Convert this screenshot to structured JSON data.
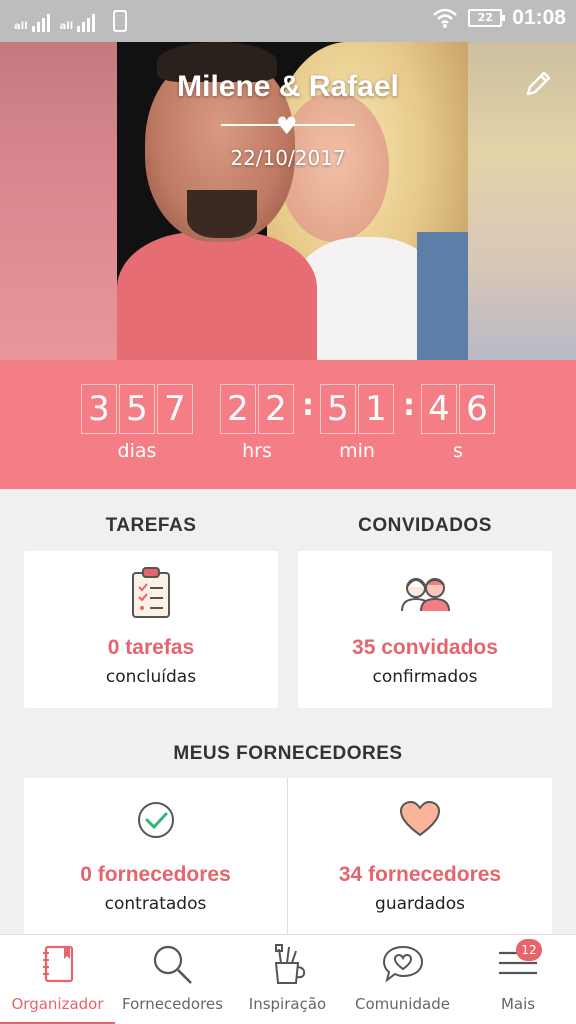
{
  "status_bar": {
    "signal1": "all",
    "signal2": "all",
    "battery": "22",
    "time": "01:08"
  },
  "header": {
    "couple_name": "Milene & Rafael",
    "date": "22/10/2017",
    "icons": [
      "heart-icon",
      "pencil-icon"
    ]
  },
  "countdown": {
    "days_digits": [
      "3",
      "5",
      "7"
    ],
    "hours_digits": [
      "2",
      "2"
    ],
    "minutes_digits": [
      "5",
      "1"
    ],
    "seconds_digits": [
      "4",
      "6"
    ],
    "separator": ":",
    "labels": {
      "days": "dias",
      "hours": "hrs",
      "minutes": "min",
      "seconds": "s"
    }
  },
  "tasks": {
    "title": "TAREFAS",
    "value": "0 tarefas",
    "sub": "concluídas",
    "icon": "clipboard-checklist-icon"
  },
  "guests": {
    "title": "CONVIDADOS",
    "value": "35 convidados",
    "sub": "confirmados",
    "icon": "guests-couple-icon"
  },
  "vendors": {
    "title": "MEUS FORNECEDORES",
    "hired": {
      "value": "0 fornecedores",
      "sub": "contratados",
      "icon": "check-circle-icon"
    },
    "saved": {
      "value": "34 fornecedores",
      "sub": "guardados",
      "icon": "heart-icon"
    }
  },
  "bottom_nav": {
    "items": [
      {
        "label": "Organizador",
        "icon": "notebook-icon",
        "active": true
      },
      {
        "label": "Fornecedores",
        "icon": "search-icon"
      },
      {
        "label": "Inspiração",
        "icon": "brushes-cup-icon"
      },
      {
        "label": "Comunidade",
        "icon": "chat-heart-icon"
      },
      {
        "label": "Mais",
        "icon": "menu-icon",
        "badge": "12"
      }
    ]
  },
  "colors": {
    "accent": "#e5656d",
    "countdown_bg": "#f57e86",
    "background": "#f0f0f0",
    "status_bar": "#bdbdbd"
  }
}
